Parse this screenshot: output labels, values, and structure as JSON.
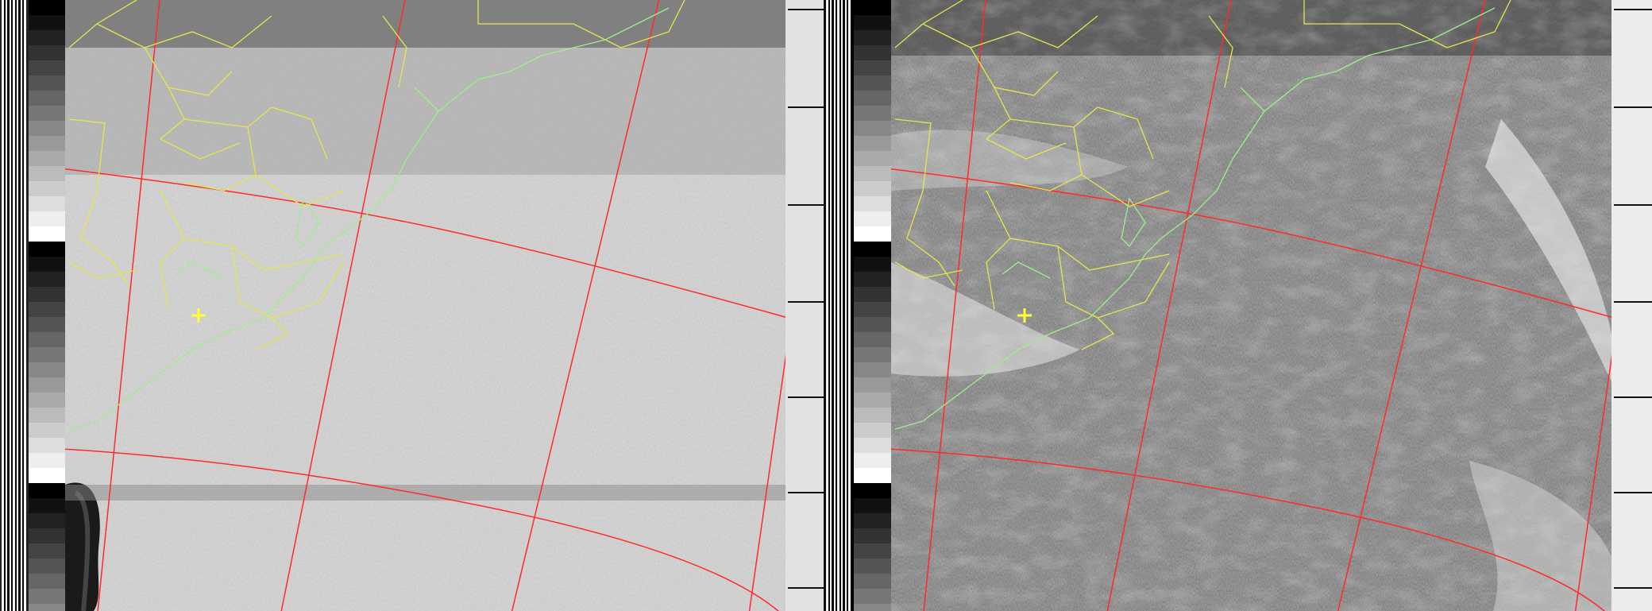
{
  "image": {
    "description_type": "APT weather satellite image",
    "channels": [
      {
        "id": "a",
        "tone": "visible",
        "background": "#c9c9c9"
      },
      {
        "id": "b",
        "tone": "infrared",
        "background": "#828282"
      }
    ],
    "overlay_colors": {
      "graticule": "#ff2a2a",
      "borders": "#e6e64a",
      "coastline": "#9cf08a",
      "marker": "#ffff33"
    },
    "marker_icon": "crosshair-plus-icon"
  }
}
